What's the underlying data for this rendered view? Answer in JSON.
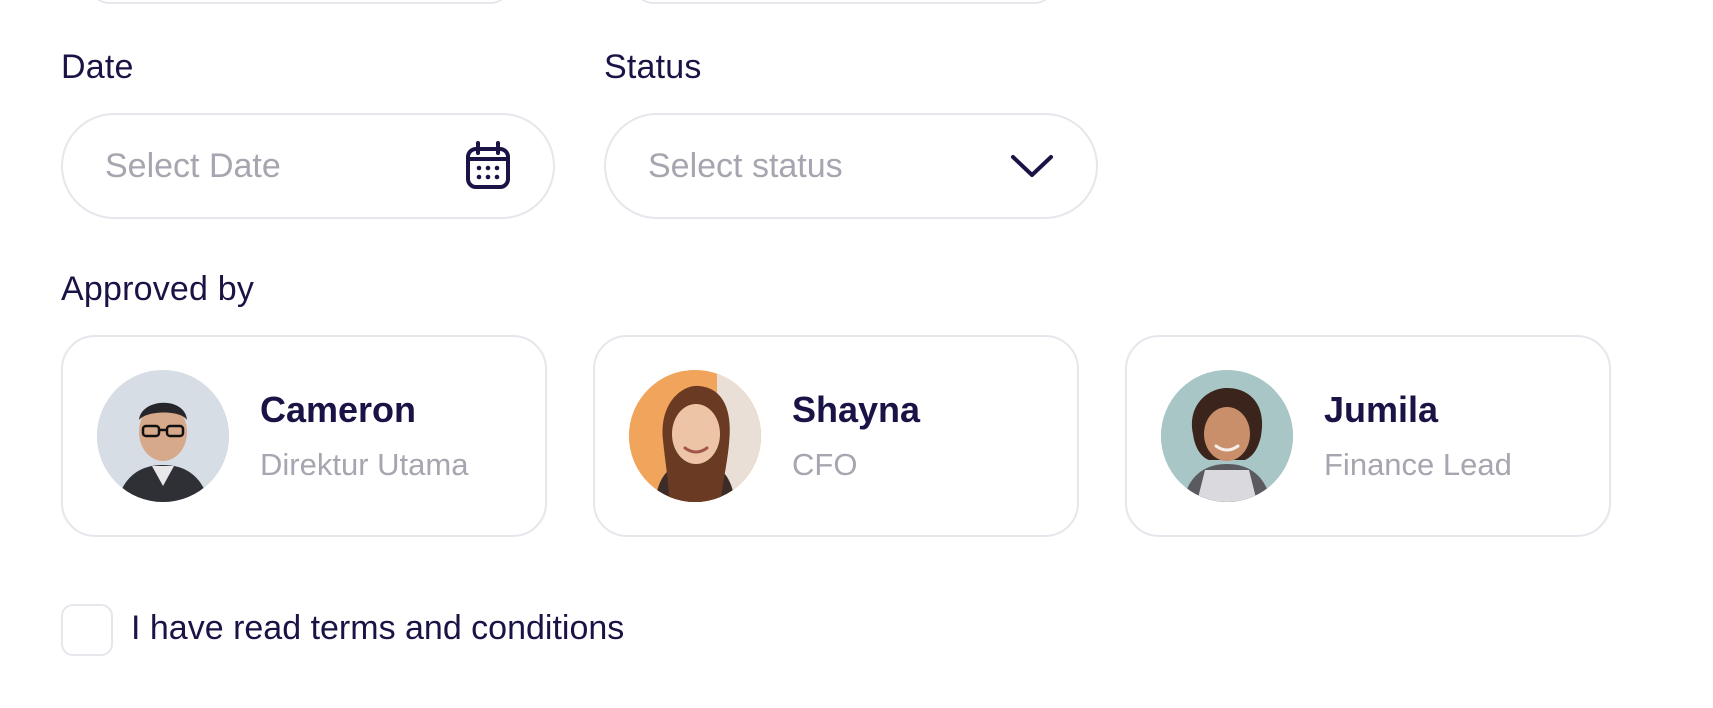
{
  "form": {
    "date_label": "Date",
    "date_placeholder": "Select Date",
    "status_label": "Status",
    "status_placeholder": "Select status",
    "approved_label": "Approved by",
    "approvers": [
      {
        "name": "Cameron",
        "role": "Direktur Utama"
      },
      {
        "name": "Shayna",
        "role": "CFO"
      },
      {
        "name": "Jumila",
        "role": "Finance Lead"
      }
    ],
    "terms_label": "I have read terms and conditions"
  },
  "colors": {
    "text": "#1a1446",
    "muted": "#a7a6b0",
    "border": "#e6e6ec"
  },
  "icons": {
    "date": "calendar-icon",
    "status": "chevron-down-icon"
  }
}
